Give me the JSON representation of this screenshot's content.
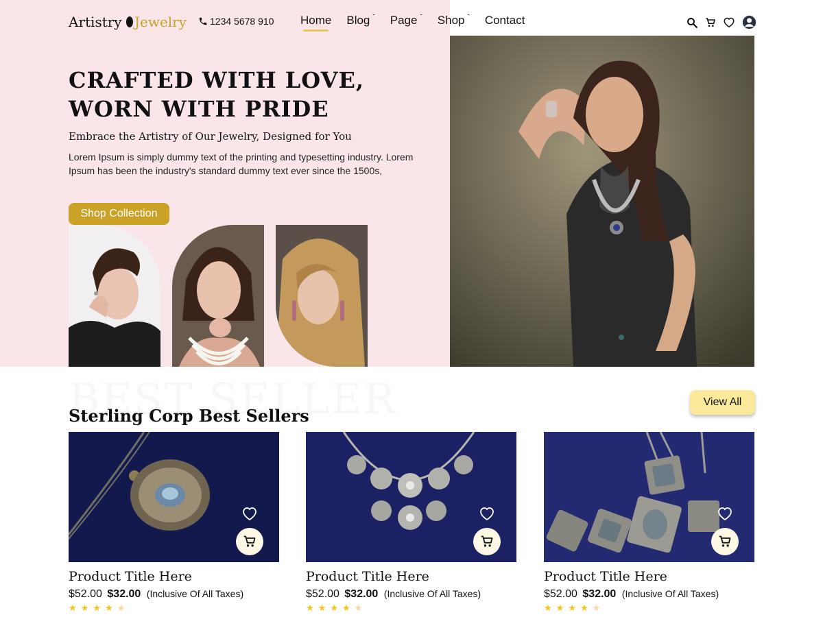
{
  "header": {
    "logo_text_1": "Artistry",
    "logo_text_2": "Jewelry",
    "phone": "1234 5678 910",
    "nav": [
      {
        "label": "Home",
        "active": true,
        "dropdown": false
      },
      {
        "label": "Blog",
        "active": false,
        "dropdown": true
      },
      {
        "label": "Page",
        "active": false,
        "dropdown": true
      },
      {
        "label": "Shop",
        "active": false,
        "dropdown": true
      },
      {
        "label": "Contact",
        "active": false,
        "dropdown": false
      }
    ],
    "icons": [
      "search-icon",
      "cart-icon",
      "heart-icon",
      "user-avatar-icon"
    ]
  },
  "hero": {
    "title_line1": "CRAFTED WITH LOVE,",
    "title_line2": "WORN WITH PRIDE",
    "subtitle": "Embrace the Artistry of Our Jewelry, Designed for You",
    "description": "Lorem Ipsum is simply dummy text of the printing and typesetting industry. Lorem Ipsum has been the industry's standard dummy text ever since the 1500s,",
    "cta_label": "Shop Collection"
  },
  "best_seller": {
    "background_text": "BEST SELLER",
    "title": "Sterling Corp Best Sellers",
    "view_all_label": "View  All",
    "products": [
      {
        "title": "Product Title Here",
        "old_price": "$52.00",
        "new_price": "$32.00",
        "tax_note": "(Inclusive Of All Taxes)",
        "rating": 4,
        "max_rating": 5
      },
      {
        "title": "Product Title Here",
        "old_price": "$52.00",
        "new_price": "$32.00",
        "tax_note": "(Inclusive Of All Taxes)",
        "rating": 4,
        "max_rating": 5
      },
      {
        "title": "Product Title Here",
        "old_price": "$52.00",
        "new_price": "$32.00",
        "tax_note": "(Inclusive Of All Taxes)",
        "rating": 4,
        "max_rating": 5
      }
    ]
  },
  "colors": {
    "accent_gold": "#c9a227",
    "hero_bg": "#fae6e8",
    "view_all_bg": "#fbe99a",
    "star": "#f6c21a"
  }
}
